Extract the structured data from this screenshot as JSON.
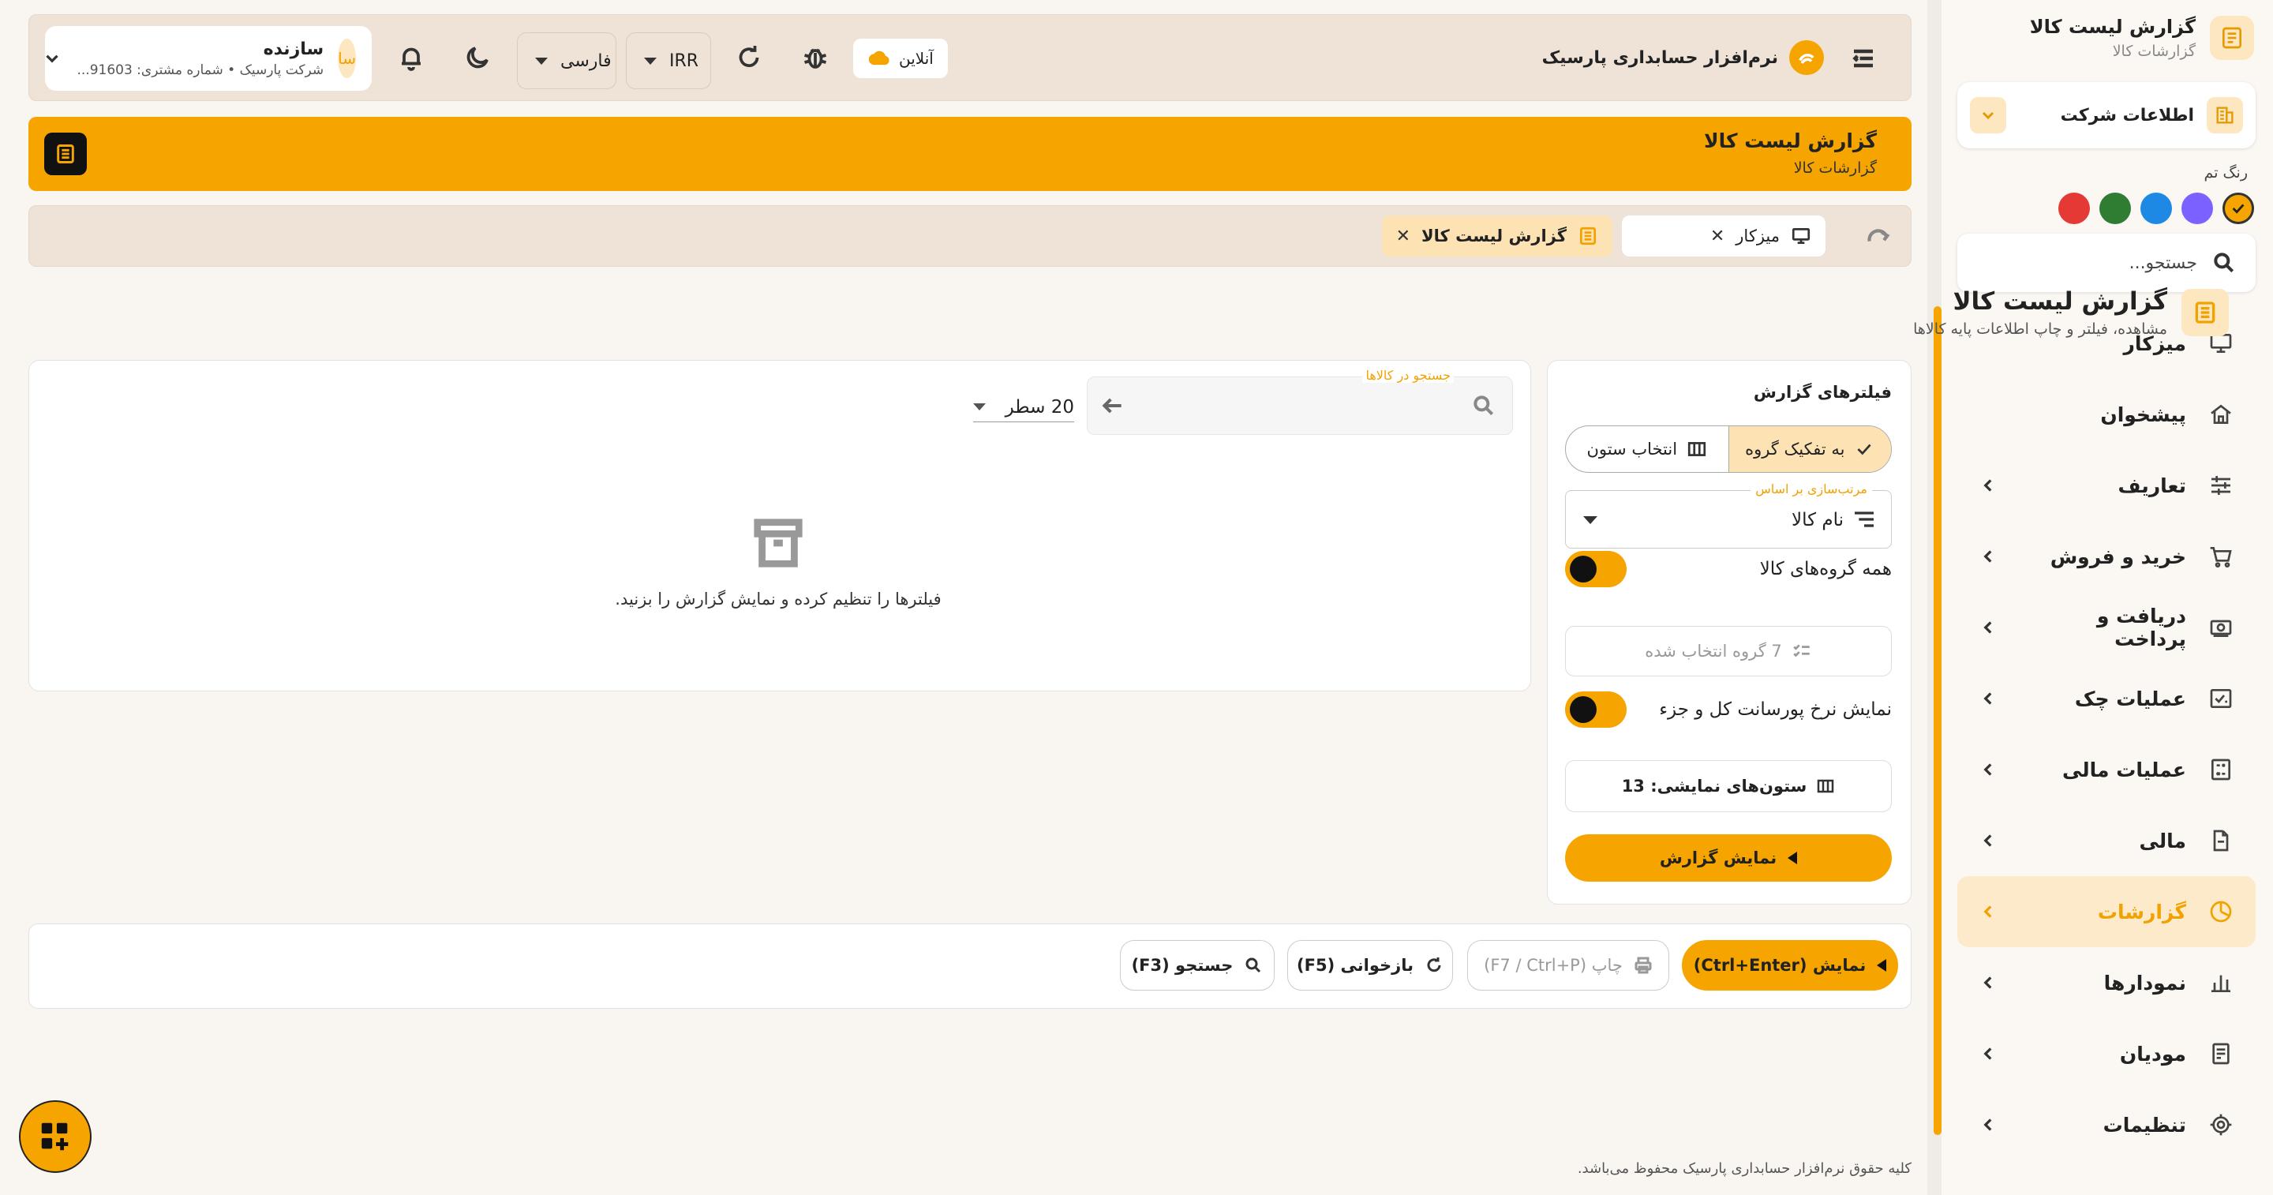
{
  "sidebar": {
    "title": "گزارش لیست کالا",
    "subtitle": "گزارشات کالا",
    "company_label": "اطلاعات شرکت",
    "theme_label": "رنگ تم",
    "theme_colors": [
      "#f6a500",
      "#7b61ff",
      "#1e88e5",
      "#2e7d32",
      "#e53935"
    ],
    "search_placeholder": "جستجو...",
    "items": [
      {
        "label": "میزکار",
        "icon": "desktop-icon"
      },
      {
        "label": "پیشخوان",
        "icon": "home-icon"
      },
      {
        "label": "تعاریف",
        "icon": "sliders-icon"
      },
      {
        "label": "خرید و فروش",
        "icon": "cart-icon"
      },
      {
        "label": "دریافت و پرداخت",
        "icon": "cash-icon"
      },
      {
        "label": "عملیات چک",
        "icon": "check-icon"
      },
      {
        "label": "عملیات مالی",
        "icon": "calculator-icon"
      },
      {
        "label": "مالی",
        "icon": "document-icon"
      },
      {
        "label": "گزارشات",
        "icon": "pie-chart-icon"
      },
      {
        "label": "نمودارها",
        "icon": "bar-chart-icon"
      },
      {
        "label": "مودیان",
        "icon": "receipt-icon"
      },
      {
        "label": "تنظیمات",
        "icon": "gear-icon"
      }
    ]
  },
  "header": {
    "app_name": "نرم‌افزار حسابداری پارسیک",
    "online_label": "آنلاین",
    "currency": "IRR",
    "language": "فارسی",
    "user_name": "سازنده",
    "user_meta": "شرکت پارسیک • شماره مشتری: 91603...",
    "avatar_text": "سا"
  },
  "banner": {
    "title": "گزارش لیست کالا",
    "subtitle": "گزارشات کالا"
  },
  "tabs": [
    {
      "label": "میزکار"
    },
    {
      "label": "گزارش لیست کالا"
    }
  ],
  "page": {
    "title": "گزارش لیست کالا",
    "subtitle": "مشاهده، فیلتر و چاپ اطلاعات پایه کالاها"
  },
  "filters": {
    "title": "فیلترهای گزارش",
    "group_by_label": "به تفکیک گروه",
    "column_select_label": "انتخاب ستون",
    "sort_label": "مرتب‌سازی بر اساس",
    "sort_value": "نام کالا",
    "all_groups_label": "همه گروه‌های کالا",
    "groups_selected": "7 گروه انتخاب شده",
    "percent_label": "نمایش نرخ پورسانت کل و جزء",
    "columns_label": "ستون‌های نمایشی: 13",
    "show_report": "نمایش گزارش"
  },
  "results": {
    "search_label": "جستجو در کالاها",
    "rows_value": "20 سطر",
    "empty_text": "فیلترها را تنظیم کرده و نمایش گزارش را بزنید."
  },
  "actions": {
    "show": "نمایش (Ctrl+Enter)",
    "print": "چاپ (F7 / Ctrl+P)",
    "reload": "بازخوانی (F5)",
    "search": "جستجو (F3)"
  },
  "footer": "کلیه حقوق نرم‌افزار حسابداری پارسیک محفوظ می‌باشد."
}
